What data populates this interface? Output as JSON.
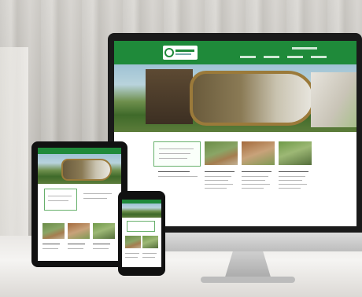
{
  "scene": {
    "description_free": true
  }
}
